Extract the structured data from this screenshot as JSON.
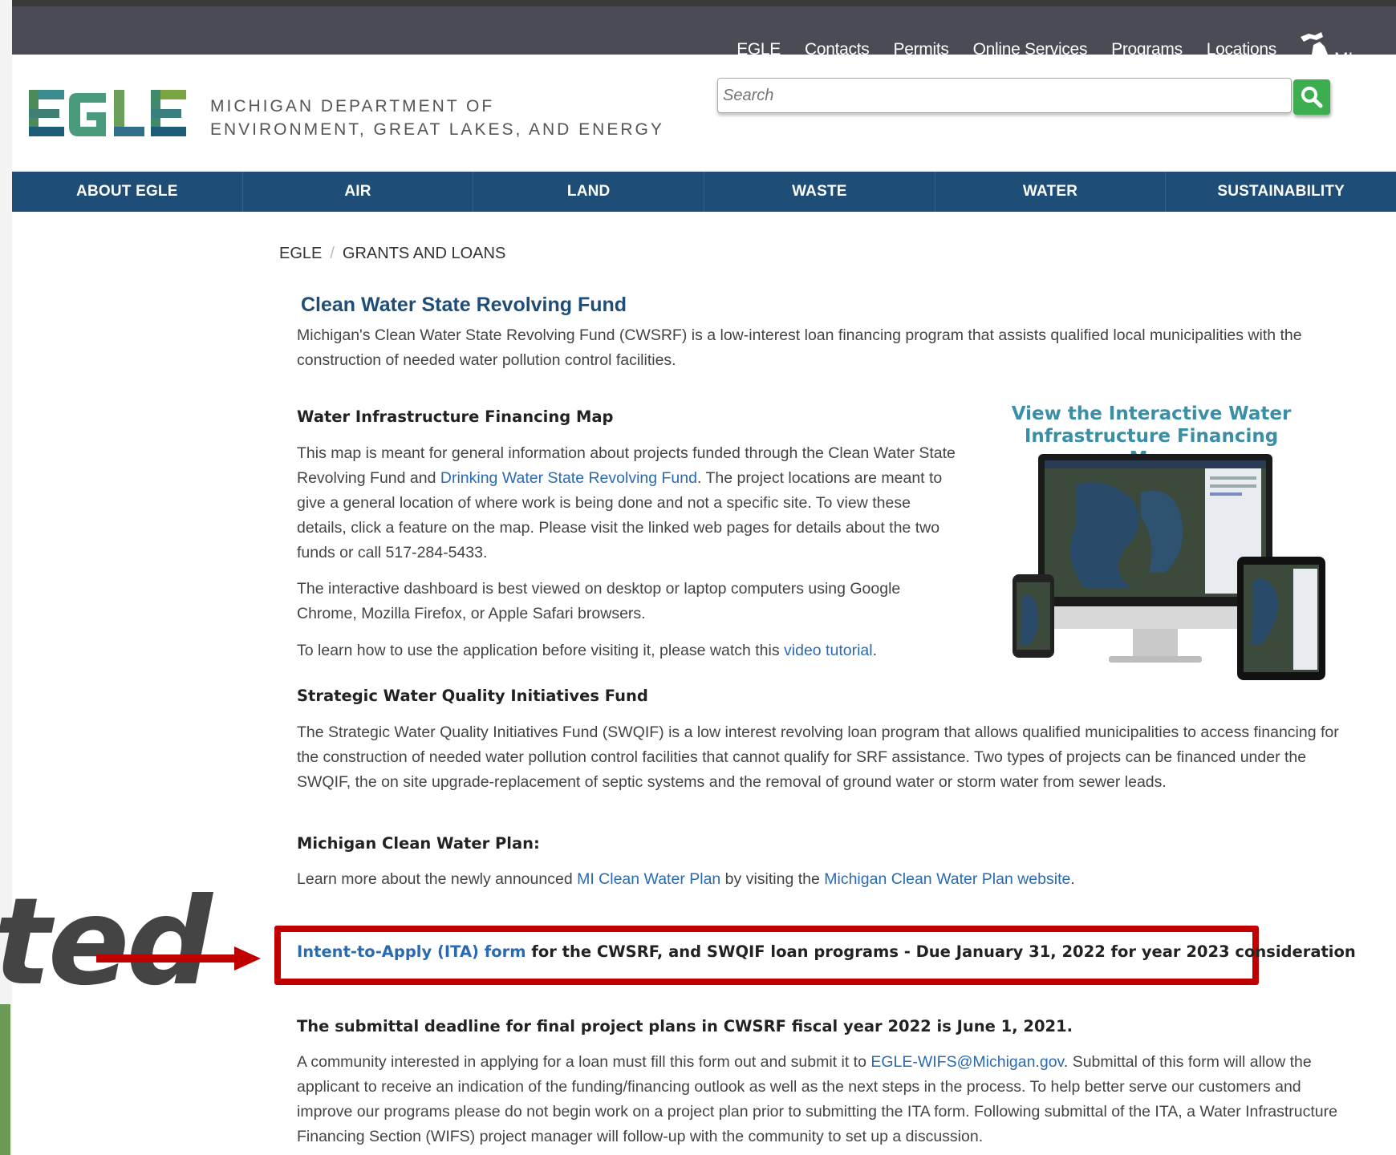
{
  "top_nav": [
    "EGLE",
    "Contacts",
    "Permits",
    "Online Services",
    "Programs",
    "Locations"
  ],
  "migov_label": "MI.gov",
  "header": {
    "logo_text": "EGLE",
    "dept_line1": "MICHIGAN DEPARTMENT OF",
    "dept_line2": "ENVIRONMENT, GREAT LAKES, AND ENERGY",
    "search_placeholder": "Search"
  },
  "main_nav": [
    "ABOUT EGLE",
    "AIR",
    "LAND",
    "WASTE",
    "WATER",
    "SUSTAINABILITY"
  ],
  "breadcrumb": [
    "EGLE",
    "GRANTS AND LOANS"
  ],
  "page_title": "Clean Water State Revolving Fund",
  "intro": "Michigan's Clean Water State Revolving Fund (CWSRF) is a low-interest loan financing program that assists qualified local municipalities with the construction of needed water pollution control facilities.",
  "map_section": {
    "heading": "Water Infrastructure Financing Map",
    "p1_a": "This map is meant for general information about projects funded through the Clean Water State Revolving Fund and ",
    "p1_link": "Drinking Water State Revolving Fund",
    "p1_b": ". The project locations are meant to give a general location of where work is being done and not a specific site. To view these details, click a feature on the map. Please visit the linked web pages for details about the two funds or call 517-284-5433.",
    "p2": "The interactive dashboard is best viewed on desktop or laptop computers using Google Chrome, Mozilla Firefox, or Apple Safari browsers.",
    "p3_a": "To learn how to use the application before visiting it, please watch this ",
    "p3_link": "video tutorial",
    "p3_b": ".",
    "image_caption_line1": "View the Interactive Water",
    "image_caption_line2": "Infrastructure Financing Map"
  },
  "swqif": {
    "heading": "Strategic Water Quality Initiatives Fund",
    "text": "The Strategic Water Quality Initiatives Fund (SWQIF) is a low interest revolving loan program that allows qualified municipalities to access financing for the construction of needed water pollution control facilities that cannot qualify for SRF assistance. Two types of projects can be financed under the SWQIF, the on site upgrade-replacement of septic systems and the removal of ground water or storm water from sewer leads."
  },
  "clean_water_plan": {
    "heading": "Michigan Clean Water Plan:",
    "text_a": "Learn more about the newly announced ",
    "link1": "MI Clean Water Plan",
    "text_b": " by visiting the ",
    "link2": "Michigan Clean Water Plan website",
    "text_c": "."
  },
  "ita": {
    "link": "Intent-to-Apply (ITA) form",
    "text": " for the CWSRF, and SWQIF loan programs - Due January 31, 2022 for year 2023 consideration"
  },
  "deadline": "The submittal deadline for final project plans in CWSRF fiscal year 2022 is June 1, 2021.",
  "community": {
    "text_a": "A community interested in applying for a loan must fill this form out and submit it to ",
    "email": "EGLE-WIFS@Michigan.gov",
    "text_b": ". Submittal of this form will allow the applicant to receive an indication of the funding/financing outlook as well as the next steps in the process. To help better serve our customers and improve our programs please do not begin work on a project plan prior to submitting the ITA form.  Following submittal of the ITA, a Water Infrastructure Financing Section (WIFS) project manager will follow-up with the community to set up a discussion."
  },
  "overlay_text": "ted",
  "colors": {
    "nav_blue": "#1e4d78",
    "link_blue": "#2a6ab1",
    "highlight_red": "#c00000",
    "search_green": "#3cae4f"
  }
}
